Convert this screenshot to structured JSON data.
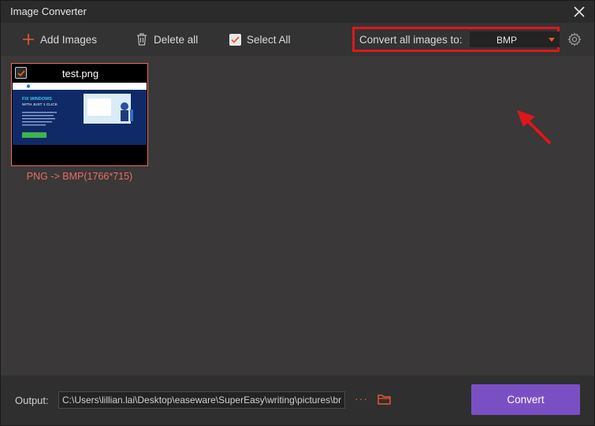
{
  "window": {
    "title": "Image Converter"
  },
  "toolbar": {
    "add_images": "Add Images",
    "delete_all": "Delete all",
    "select_all": "Select All",
    "select_all_checked": true,
    "convert_all_label": "Convert all images to:",
    "format_value": "BMP"
  },
  "files": [
    {
      "name": "test.png",
      "checked": true,
      "conversion": "PNG -> BMP(1766*715)",
      "thumbnail_text": {
        "headline_1": "FIX WINDOWS",
        "headline_2": "WITH JUST 1 CLICK"
      }
    }
  ],
  "footer": {
    "output_label": "Output:",
    "output_path": "C:\\Users\\lillian.lai\\Desktop\\easeware\\SuperEasy\\writing\\pictures\\br",
    "more_symbol": "···",
    "convert_label": "Convert"
  },
  "colors": {
    "accent_orange": "#e85a2c",
    "highlight_red": "#e0161c",
    "convert_purple": "#7b4fc4",
    "card_border": "#e56d62"
  },
  "icons": [
    "close-icon",
    "plus-icon",
    "trash-icon",
    "checkbox-icon",
    "chevron-down-icon",
    "gear-icon",
    "more-icon",
    "folder-icon"
  ]
}
